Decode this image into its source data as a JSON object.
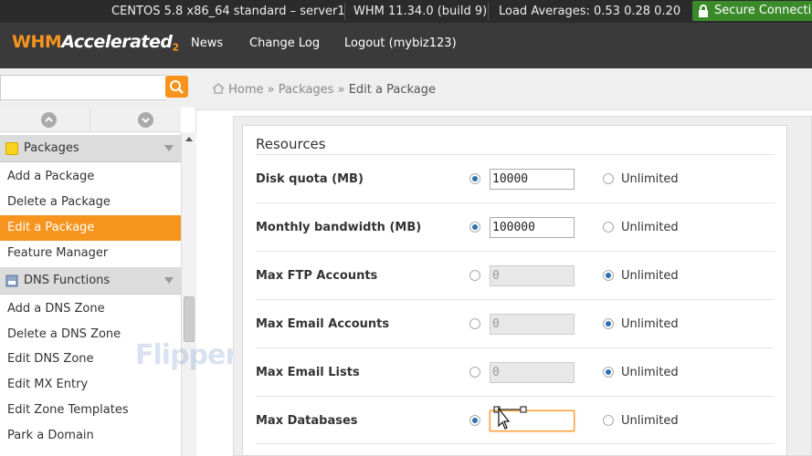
{
  "statusbar": {
    "os": "CENTOS 5.8 x86_64 standard – server1",
    "version": "WHM 11.34.0 (build 9)",
    "load": "Load Averages: 0.53 0.28 0.20",
    "secure": "Secure Connection"
  },
  "header": {
    "logo": {
      "whm": "WHM",
      "accelerated": "Accelerated",
      "two": "2"
    },
    "nav": [
      "News",
      "Change Log",
      "Logout (mybiz123)"
    ]
  },
  "search": {
    "value": "",
    "placeholder": ""
  },
  "breadcrumb": {
    "home": "Home",
    "sep": "»",
    "packages": "Packages",
    "current": "Edit a Package"
  },
  "sidebar": {
    "packages_header": "Packages",
    "packages_items": [
      "Add a Package",
      "Delete a Package",
      "Edit a Package",
      "Feature Manager"
    ],
    "dns_header": "DNS Functions",
    "dns_items": [
      "Add a DNS Zone",
      "Delete a DNS Zone",
      "Edit DNS Zone",
      "Edit MX Entry",
      "Edit Zone Templates",
      "Park a Domain"
    ]
  },
  "watermark": "FlipperHost",
  "resources": {
    "title": "Resources",
    "unlimited_label": "Unlimited",
    "rows": [
      {
        "label": "Disk quota (MB)",
        "value": "10000",
        "limited": true
      },
      {
        "label": "Monthly bandwidth (MB)",
        "value": "100000",
        "limited": true
      },
      {
        "label": "Max FTP Accounts",
        "value": "0",
        "limited": false
      },
      {
        "label": "Max Email Accounts",
        "value": "0",
        "limited": false
      },
      {
        "label": "Max Email Lists",
        "value": "0",
        "limited": false
      },
      {
        "label": "Max Databases",
        "value": "",
        "limited": true
      }
    ]
  },
  "colors": {
    "accent": "#f7941e",
    "header": "#3a3a3a",
    "statusbar": "#2b2b2b",
    "secure": "#3b8a2a"
  }
}
